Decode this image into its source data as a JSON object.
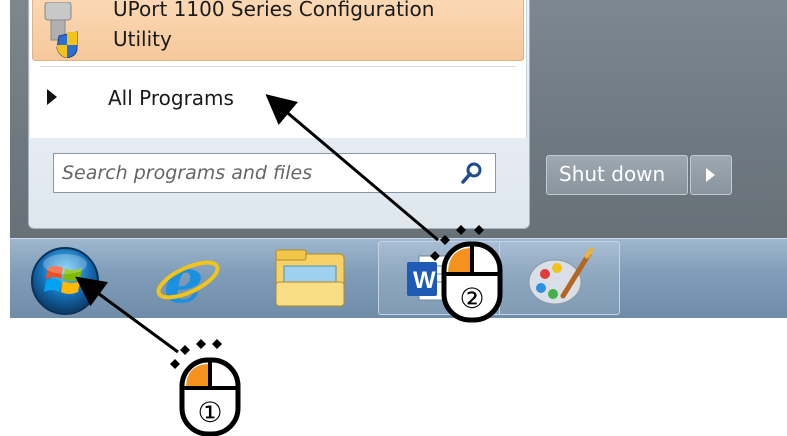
{
  "start_menu": {
    "pinned_program": {
      "line1": "UPort 1100 Series Configuration",
      "line2": "Utility"
    },
    "all_programs_label": "All Programs",
    "search": {
      "placeholder": "Search programs and files"
    },
    "shutdown_label": "Shut down"
  },
  "taskbar": {
    "items": [
      "start-orb",
      "internet-explorer",
      "windows-explorer",
      "word",
      "paint"
    ],
    "word_letter": "W"
  },
  "annotations": {
    "step1_label": "①",
    "step2_label": "②",
    "mouse_button_color": "#f5921e"
  }
}
